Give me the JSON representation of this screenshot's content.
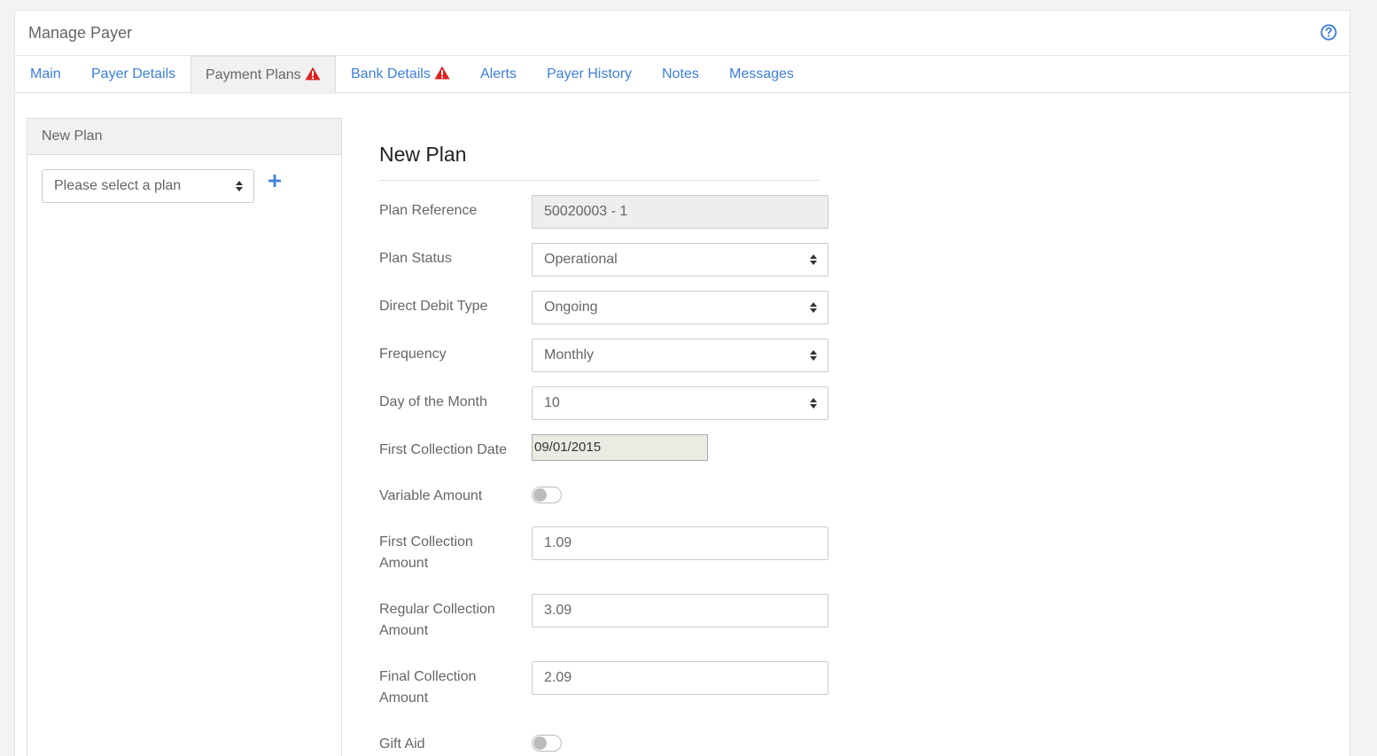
{
  "header": {
    "title": "Manage Payer"
  },
  "tabs": [
    {
      "label": "Main"
    },
    {
      "label": "Payer Details"
    },
    {
      "label": "Payment Plans",
      "warning": true,
      "active": true
    },
    {
      "label": "Bank Details",
      "warning": true
    },
    {
      "label": "Alerts"
    },
    {
      "label": "Payer History"
    },
    {
      "label": "Notes"
    },
    {
      "label": "Messages"
    }
  ],
  "sidebar": {
    "heading": "New Plan",
    "plan_select_placeholder": "Please select a plan"
  },
  "form": {
    "title": "New Plan",
    "plan_reference": {
      "label": "Plan Reference",
      "value": "50020003 - 1"
    },
    "plan_status": {
      "label": "Plan Status",
      "value": "Operational"
    },
    "direct_debit_type": {
      "label": "Direct Debit Type",
      "value": "Ongoing"
    },
    "frequency": {
      "label": "Frequency",
      "value": "Monthly"
    },
    "day_of_month": {
      "label": "Day of the Month",
      "value": "10"
    },
    "first_collection_date": {
      "label": "First Collection Date",
      "value": "09/01/2015"
    },
    "variable_amount": {
      "label": "Variable Amount",
      "on": false
    },
    "first_collection_amount": {
      "label_line1": "First Collection",
      "label_line2": "Amount",
      "value": "1.09"
    },
    "regular_collection_amount": {
      "label_line1": "Regular Collection",
      "label_line2": "Amount",
      "value": "3.09"
    },
    "final_collection_amount": {
      "label_line1": "Final Collection",
      "label_line2": "Amount",
      "value": "2.09"
    },
    "gift_aid": {
      "label": "Gift Aid",
      "on": false
    }
  },
  "colors": {
    "link": "#3d7fdc",
    "warning": "#e02020",
    "active_tab_bg": "#f1f1f1"
  }
}
